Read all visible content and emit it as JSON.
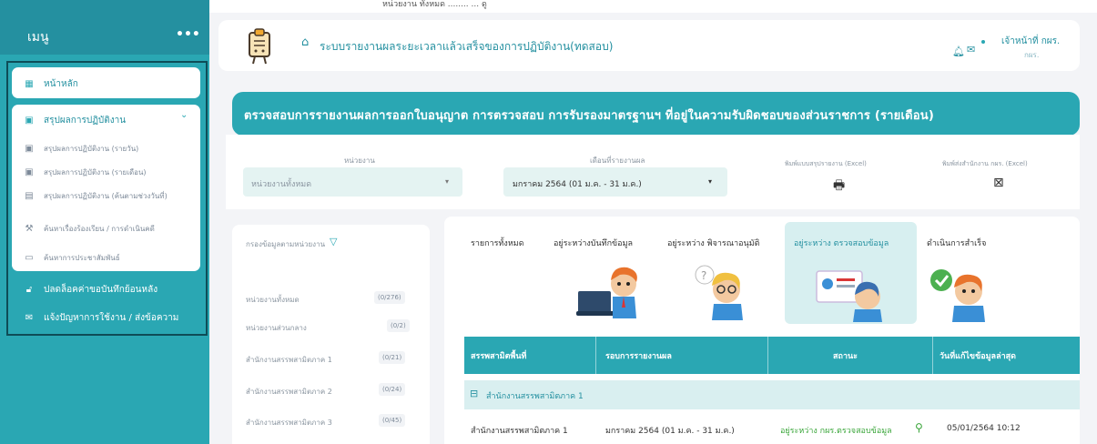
{
  "caption": "หน่วยงาน ทั้งหมด ........ ... ดู",
  "sidebar": {
    "title": "เมนู",
    "dots": "•••",
    "home": {
      "label": "หน้าหลัก",
      "icon": "grid-icon"
    },
    "group": {
      "label": "สรุปผลการปฏิบัติงาน",
      "chevron": "⌄",
      "icon": "calendar-icon"
    },
    "items": [
      {
        "label": "สรุปผลการปฏิบัติงาน (รายวัน)",
        "icon": "calendar-icon"
      },
      {
        "label": "สรุปผลการปฏิบัติงาน (รายเดือน)",
        "icon": "calendar-icon"
      },
      {
        "label": "สรุปผลการปฏิบัติงาน (ค้นตามช่วงวันที่)",
        "icon": "document-icon"
      },
      {
        "label": "ค้นหาเรื่องร้องเรียน / การดำเนินคดี",
        "icon": "gavel-icon"
      },
      {
        "label": "ค้นหาการประชาสัมพันธ์",
        "icon": "monitor-icon"
      }
    ],
    "unlock": {
      "label": "ปลดล็อคค่าขอบันทึกย้อนหลัง",
      "icon": "lock-icon"
    },
    "report": {
      "label": "แจ้งปัญหาการใช้งาน / ส่งข้อความ",
      "icon": "mail-icon"
    }
  },
  "header": {
    "title": "ระบบรายงานผลระยะเวลาแล้วเสร็จของการปฏิบัติงาน(ทดสอบ)",
    "home_icon": "⌂",
    "user_name": "เจ้าหน้าที่ กผร.",
    "user_org": "กผร."
  },
  "banner": {
    "text": "ตรวจสอบการรายงานผลการออกใบอนุญาต การตรวจสอบ การรับรองมาตรฐานฯ ที่อยู่ในความรับผิดชอบของส่วนราชการ (รายเดือน)"
  },
  "filter": {
    "agency_label": "หน่วยงาน",
    "agency_value": "หน่วยงานทั้งหมด",
    "month_label": "เดือนที่รายงานผล",
    "month_value": "มกราคม 2564 (01 ม.ค. - 31 ม.ค.)",
    "print_label": "พิมพ์แบบสรุปรายงาน (Excel)",
    "export_label": "พิมพ์ส่งสำนักงาน กผร. (Excel)",
    "caret": "▾",
    "print_icon": "🖶",
    "excel_icon": "⊠"
  },
  "left_panel": {
    "header": "กรองข้อมูลตามหน่วยงาน",
    "filter_icon": "▽",
    "rows": [
      {
        "label": "หน่วยงานทั้งหมด",
        "count": "(0/276)"
      },
      {
        "label": "หน่วยงานส่วนกลาง",
        "count": "(0/2)"
      },
      {
        "label": "สำนักงานสรรพสามิตภาค 1",
        "count": "(0/21)"
      },
      {
        "label": "สำนักงานสรรพสามิตภาค 2",
        "count": "(0/24)"
      },
      {
        "label": "สำนักงานสรรพสามิตภาค 3",
        "count": "(0/45)"
      }
    ]
  },
  "tabs": [
    {
      "label": "รายการทั้งหมด"
    },
    {
      "label": "อยู่ระหว่างบันทึกข้อมูล"
    },
    {
      "label": "อยู่ระหว่าง พิจารณาอนุมัติ"
    },
    {
      "label": "อยู่ระหว่าง ตรวจสอบข้อมูล"
    },
    {
      "label": "ดำเนินการสำเร็จ"
    }
  ],
  "table": {
    "columns": [
      "สรรพสามิตพื้นที่",
      "รอบการรายงานผล",
      "สถานะ",
      "วันที่แก้ไขข้อมูลล่าสุด"
    ],
    "group": "สำนักงานสรรพสามิตภาค 1",
    "rows": [
      {
        "area": "สำนักงานสรรพสามิตภาค 1",
        "period": "มกราคม 2564 (01 ม.ค. - 31 ม.ค.)",
        "status": "อยู่ระหว่าง กผร.ตรวจสอบข้อมูล",
        "updated": "05/01/2564 10:12"
      }
    ]
  },
  "colors": {
    "primary": "#2aa7b3",
    "dark": "#2490a0",
    "active_tab": "#d7eff0"
  }
}
